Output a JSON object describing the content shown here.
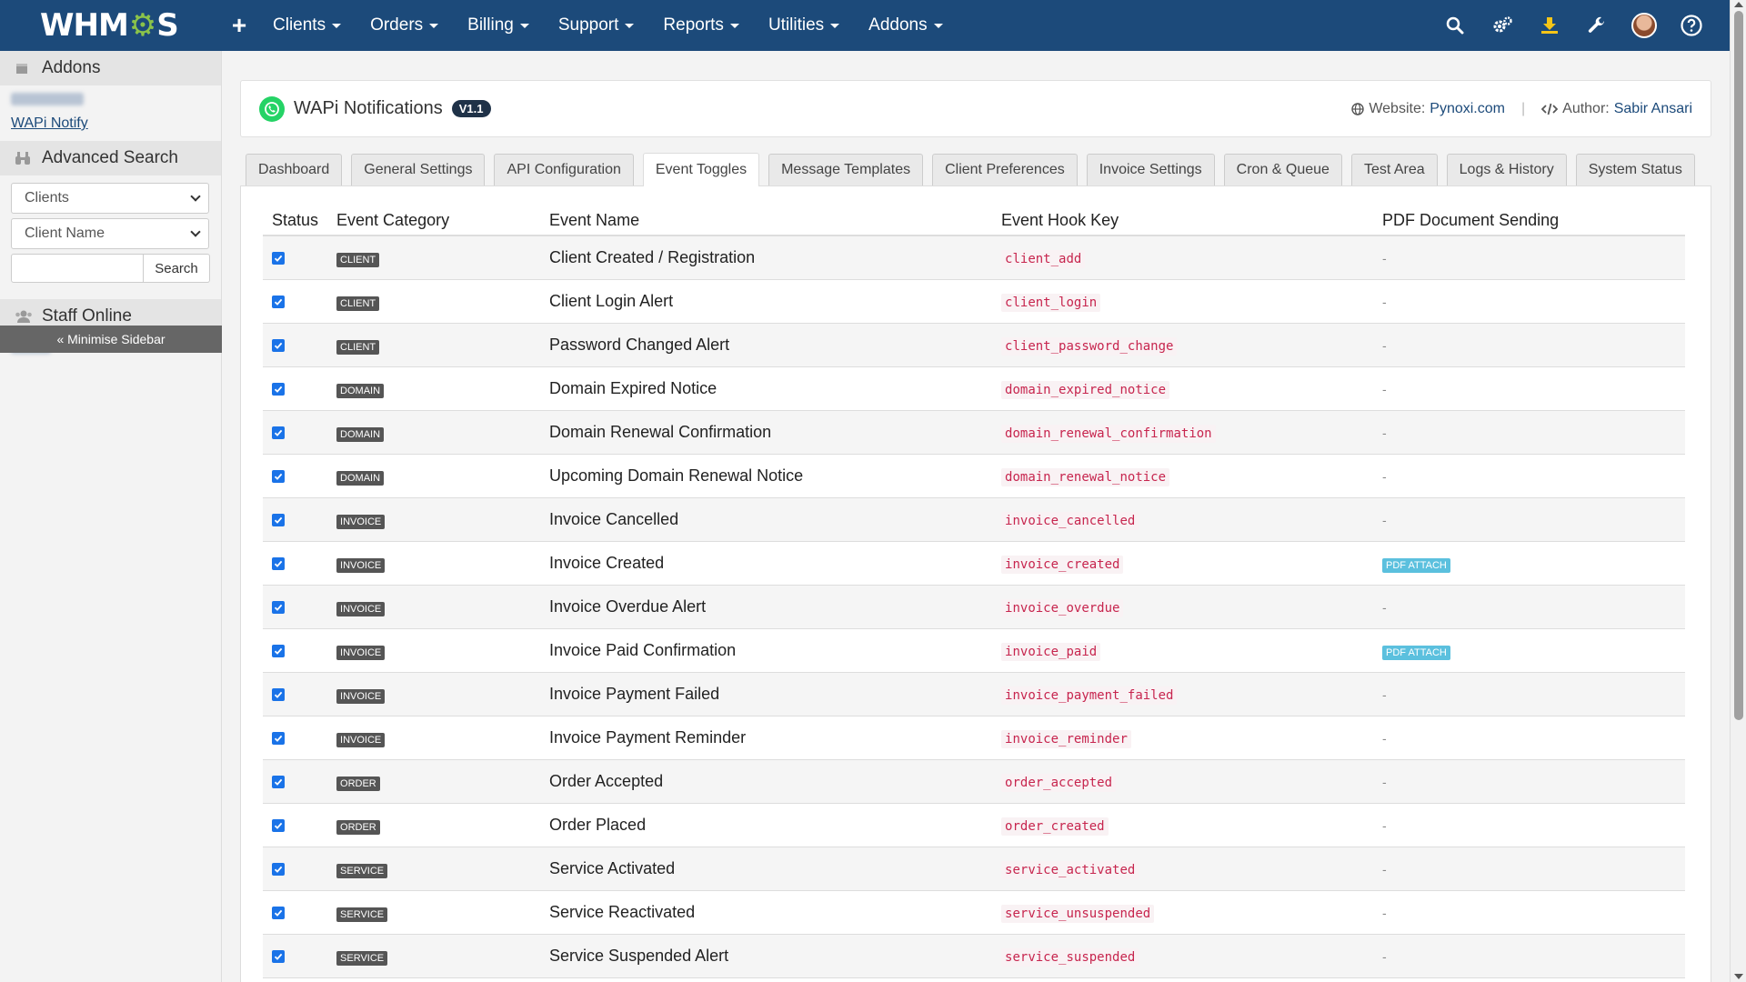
{
  "topbar": {
    "logo": {
      "left": "WHM",
      "gear": "⚙",
      "right": "S"
    },
    "plus": "+",
    "menus": [
      "Clients",
      "Orders",
      "Billing",
      "Support",
      "Reports",
      "Utilities",
      "Addons"
    ],
    "icons": [
      "search-icon",
      "settings-icon",
      "download-icon",
      "wrench-icon",
      "avatar",
      "help-icon"
    ]
  },
  "sidebar": {
    "addons_title": "Addons",
    "addon_link": "WAPi Notify",
    "advanced_title": "Advanced Search",
    "select1": "Clients",
    "select2": "Client Name",
    "search_btn": "Search",
    "staff_title": "Staff Online",
    "minimise": "« Minimise Sidebar"
  },
  "module": {
    "title": "WAPi Notifications",
    "version": "V1.1",
    "website_label": "Website:",
    "website": "Pynoxi.com",
    "author_label": "Author:",
    "author": "Sabir Ansari"
  },
  "tabs": [
    "Dashboard",
    "General Settings",
    "API Configuration",
    "Event Toggles",
    "Message Templates",
    "Client Preferences",
    "Invoice Settings",
    "Cron & Queue",
    "Test Area",
    "Logs & History",
    "System Status"
  ],
  "active_tab": "Event Toggles",
  "table": {
    "headers": [
      "Status",
      "Event Category",
      "Event Name",
      "Event Hook Key",
      "PDF Document Sending"
    ],
    "rows": [
      {
        "cat": "CLIENT",
        "name": "Client Created / Registration",
        "hook": "client_add",
        "pdf": "-"
      },
      {
        "cat": "CLIENT",
        "name": "Client Login Alert",
        "hook": "client_login",
        "pdf": "-"
      },
      {
        "cat": "CLIENT",
        "name": "Password Changed Alert",
        "hook": "client_password_change",
        "pdf": "-"
      },
      {
        "cat": "DOMAIN",
        "name": "Domain Expired Notice",
        "hook": "domain_expired_notice",
        "pdf": "-"
      },
      {
        "cat": "DOMAIN",
        "name": "Domain Renewal Confirmation",
        "hook": "domain_renewal_confirmation",
        "pdf": "-"
      },
      {
        "cat": "DOMAIN",
        "name": "Upcoming Domain Renewal Notice",
        "hook": "domain_renewal_notice",
        "pdf": "-"
      },
      {
        "cat": "INVOICE",
        "name": "Invoice Cancelled",
        "hook": "invoice_cancelled",
        "pdf": "-"
      },
      {
        "cat": "INVOICE",
        "name": "Invoice Created",
        "hook": "invoice_created",
        "pdf": "PDF ATTACH"
      },
      {
        "cat": "INVOICE",
        "name": "Invoice Overdue Alert",
        "hook": "invoice_overdue",
        "pdf": "-"
      },
      {
        "cat": "INVOICE",
        "name": "Invoice Paid Confirmation",
        "hook": "invoice_paid",
        "pdf": "PDF ATTACH"
      },
      {
        "cat": "INVOICE",
        "name": "Invoice Payment Failed",
        "hook": "invoice_payment_failed",
        "pdf": "-"
      },
      {
        "cat": "INVOICE",
        "name": "Invoice Payment Reminder",
        "hook": "invoice_reminder",
        "pdf": "-"
      },
      {
        "cat": "ORDER",
        "name": "Order Accepted",
        "hook": "order_accepted",
        "pdf": "-"
      },
      {
        "cat": "ORDER",
        "name": "Order Placed",
        "hook": "order_created",
        "pdf": "-"
      },
      {
        "cat": "SERVICE",
        "name": "Service Activated",
        "hook": "service_activated",
        "pdf": "-"
      },
      {
        "cat": "SERVICE",
        "name": "Service Reactivated",
        "hook": "service_unsuspended",
        "pdf": "-"
      },
      {
        "cat": "SERVICE",
        "name": "Service Suspended Alert",
        "hook": "service_suspended",
        "pdf": "-"
      }
    ]
  },
  "colors": {
    "nav": "#1c4a7a",
    "accent": "#1a73e8",
    "category_badge": "#555555",
    "pdf_badge": "#5bc0de",
    "hook_text": "#c7254e"
  }
}
